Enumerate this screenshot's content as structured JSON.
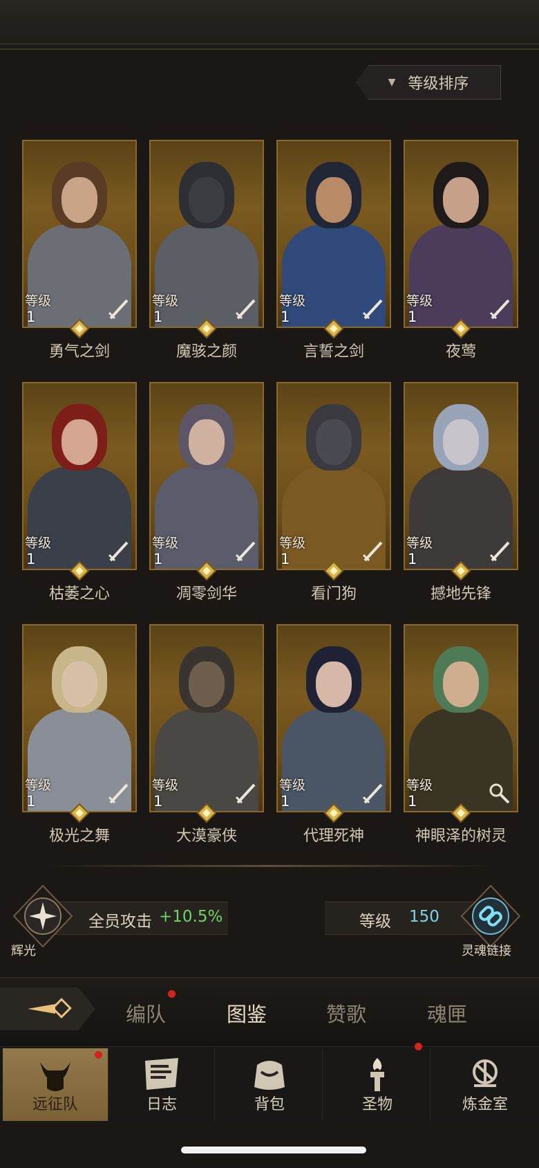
{
  "sort_button": {
    "label": "等级排序"
  },
  "level_label": "等级",
  "cards": [
    {
      "name": "勇气之剑",
      "level": "1",
      "icon": "sword-icon",
      "skin": "#c9a488",
      "hair": "#5a3b24",
      "armor": "#6b6e74"
    },
    {
      "name": "魔骇之颜",
      "level": "1",
      "icon": "sword-icon",
      "skin": "#3b3d43",
      "hair": "#2d2f35",
      "armor": "#5b5e64"
    },
    {
      "name": "言誓之剑",
      "level": "1",
      "icon": "sword-icon",
      "skin": "#b88a66",
      "hair": "#202636",
      "armor": "#2f4a7a"
    },
    {
      "name": "夜莺",
      "level": "1",
      "icon": "sword-icon",
      "skin": "#c7a08a",
      "hair": "#1e1a1a",
      "armor": "#4a3c5a"
    },
    {
      "name": "枯萎之心",
      "level": "1",
      "icon": "sword-icon",
      "skin": "#d4a590",
      "hair": "#7e1e18",
      "armor": "#3a3f4a"
    },
    {
      "name": "凋零剑华",
      "level": "1",
      "icon": "sword-icon",
      "skin": "#cfb3a0",
      "hair": "#5b5566",
      "armor": "#5a5c6b"
    },
    {
      "name": "看门狗",
      "level": "1",
      "icon": "sword-icon",
      "skin": "#4a4a52",
      "hair": "#3a3a40",
      "armor": "#7a5a22"
    },
    {
      "name": "撼地先锋",
      "level": "1",
      "icon": "sword-icon",
      "skin": "#c8c4cc",
      "hair": "#9aa4b8",
      "armor": "#3e3a3a"
    },
    {
      "name": "极光之舞",
      "level": "1",
      "icon": "sword-icon",
      "skin": "#d8c0a8",
      "hair": "#c8b68a",
      "armor": "#8a8e96"
    },
    {
      "name": "大漠豪侠",
      "level": "1",
      "icon": "sword-icon",
      "skin": "#6e5e4e",
      "hair": "#3a3430",
      "armor": "#4a4844"
    },
    {
      "name": "代理死神",
      "level": "1",
      "icon": "sword-icon",
      "skin": "#d6b8a8",
      "hair": "#1f2234",
      "armor": "#4a5566"
    },
    {
      "name": "神眼泽的树灵",
      "level": "1",
      "icon": "staff-icon",
      "skin": "#cfae90",
      "hair": "#4f7a56",
      "armor": "#3a3424"
    }
  ],
  "bonus": {
    "left_emblem_label": "辉光",
    "stat_label": "全员攻击",
    "stat_value": "+10.5%",
    "level_label": "等级",
    "level_value": "150",
    "right_emblem_label": "灵魂链接"
  },
  "tabs": [
    {
      "label": "编队",
      "dot": true
    },
    {
      "label": "图鉴",
      "active": true
    },
    {
      "label": "赞歌"
    },
    {
      "label": "魂匣"
    }
  ],
  "nav": [
    {
      "label": "远征队",
      "icon": "helmet-icon",
      "active": true,
      "dot": true
    },
    {
      "label": "日志",
      "icon": "scroll-icon"
    },
    {
      "label": "背包",
      "icon": "bag-icon"
    },
    {
      "label": "圣物",
      "icon": "torch-icon",
      "dot": true
    },
    {
      "label": "炼金室",
      "icon": "alchemy-icon"
    }
  ],
  "colors": {
    "accent_gold": "#8a6a2a",
    "stat_green": "#6fd36a",
    "level_blue": "#7fd3e6",
    "dot_red": "#d2231c"
  }
}
